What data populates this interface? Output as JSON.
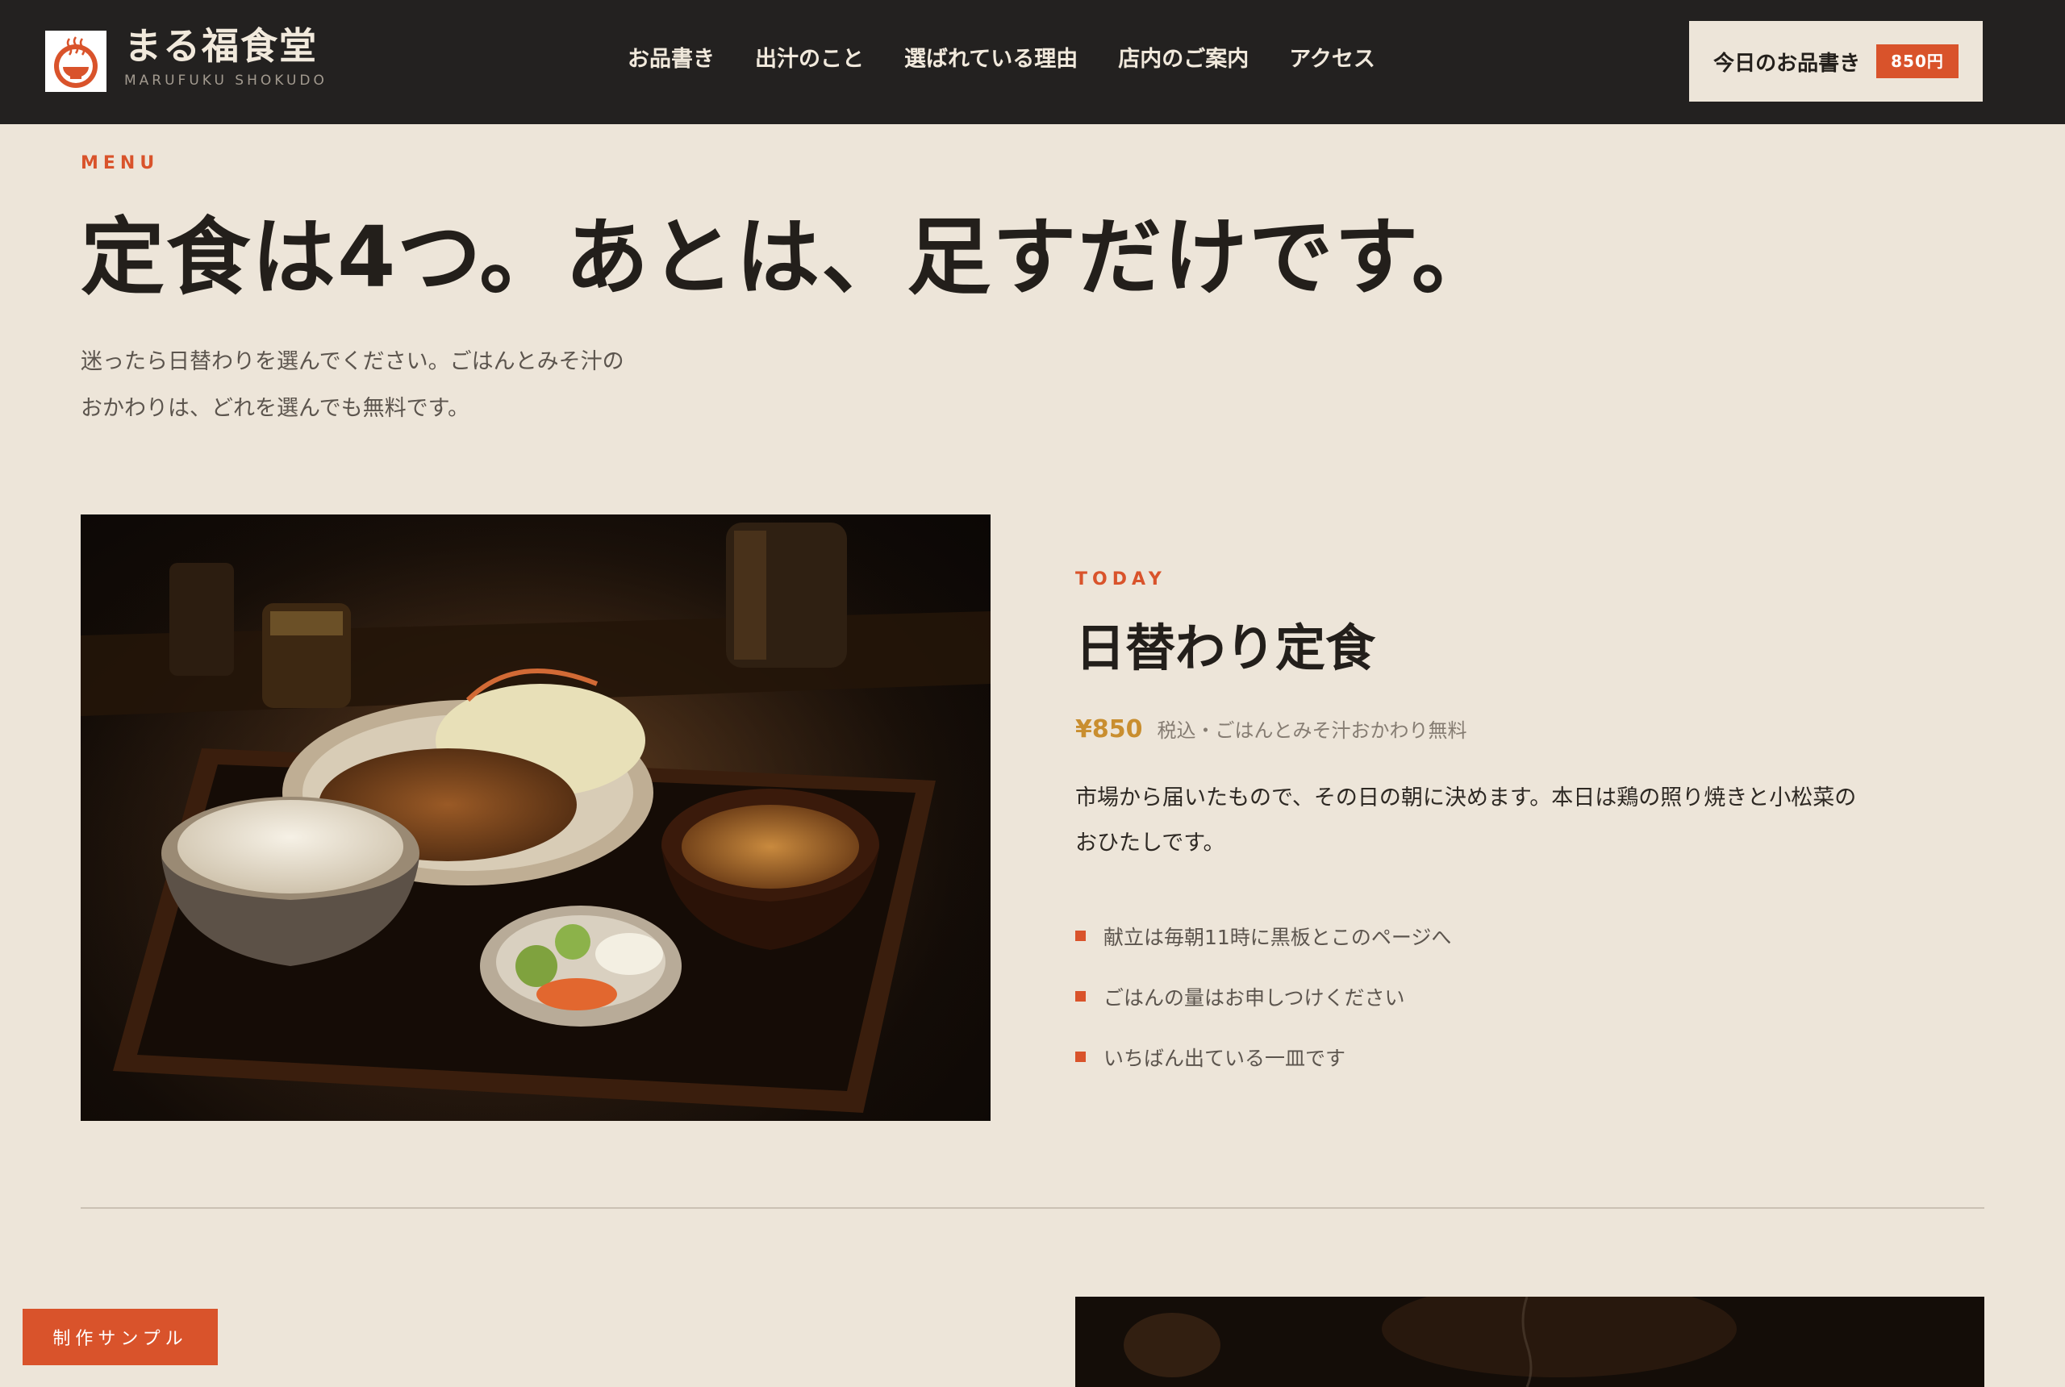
{
  "brand": {
    "name": "まる福食堂",
    "romaji": "MARUFUKU SHOKUDO",
    "logo_icon": "steaming-bowl-icon"
  },
  "nav": {
    "items": [
      "お品書き",
      "出汁のこと",
      "選ばれている理由",
      "店内のご案内",
      "アクセス"
    ]
  },
  "cta": {
    "label": "今日のお品書き",
    "badge": "850円"
  },
  "intro": {
    "eyebrow": "MENU",
    "title": "定食は4つ。あとは、足すだけです。",
    "lead_line1": "迷ったら日替わりを選んでください。ごはんとみそ汁の",
    "lead_line2": "おかわりは、どれを選んでも無料です。"
  },
  "featured": {
    "eyebrow": "TODAY",
    "title": "日替わり定食",
    "price": "¥850",
    "price_note": "税込・ごはんとみそ汁おかわり無料",
    "desc_line1": "市場から届いたもので、その日の朝に決めます。本日は鶏の照り焼きと小松菜の",
    "desc_line2": "おひたしです。",
    "points": [
      "献立は毎朝11時に黒板とこのページへ",
      "ごはんの量はお申しつけください",
      "いちばん出ている一皿です"
    ]
  },
  "sample_badge": "制作サンプル",
  "colors": {
    "background": "#ede5d9",
    "header": "#232120",
    "accent": "#d9532b",
    "price": "#c98e2f"
  }
}
